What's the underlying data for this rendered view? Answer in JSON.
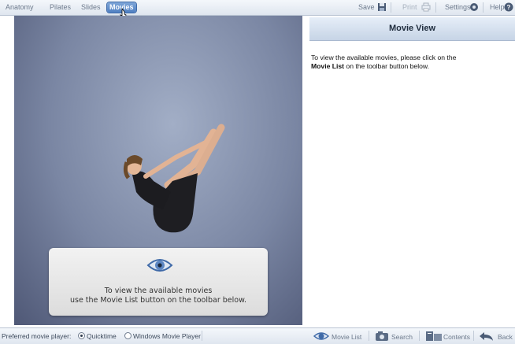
{
  "toolbar": {
    "tabs": [
      "Anatomy",
      "Pilates",
      "Slides",
      "Movies"
    ],
    "active_tab": "Movies",
    "save_label": "Save",
    "print_label": "Print",
    "settings_label": "Settings",
    "help_label": "Help"
  },
  "video": {
    "message_line1": "To view the available movies",
    "message_line2": "use the Movie List button on the toolbar below."
  },
  "right_panel": {
    "title": "Movie View",
    "text_line1": "To view the available movies, please click on the",
    "text_bold": "Movie List",
    "text_rest": " on the toolbar button below."
  },
  "bottom": {
    "preferred_label": "Preferred movie player:",
    "options": [
      "Quicktime",
      "Windows Movie Player"
    ],
    "selected": "Quicktime",
    "buttons": [
      "Movie List",
      "Search",
      "Contents",
      "Back"
    ]
  },
  "colors": {
    "accent": "#4f7fc2",
    "toolbar_bg": "#dfe6ef",
    "video_bg": "#7a86a3"
  }
}
